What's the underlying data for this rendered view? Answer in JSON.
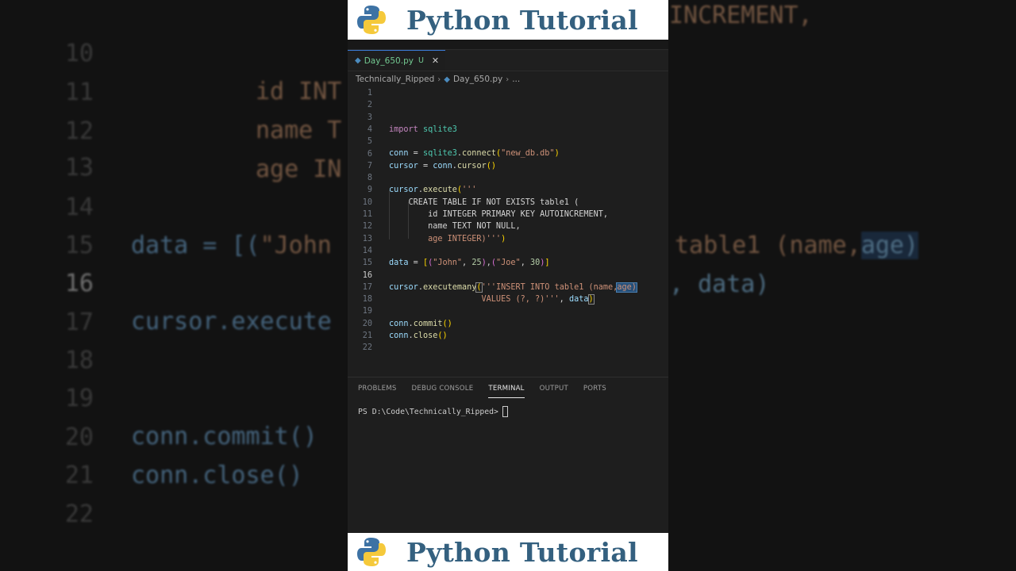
{
  "banner": {
    "title": "Python Tutorial"
  },
  "editor": {
    "tab": {
      "filename": "Day_650.py",
      "modified_badge": "U",
      "close_glyph": "✕"
    },
    "breadcrumb": {
      "folder": "Technically_Ripped",
      "file": "Day_650.py",
      "more": "..."
    },
    "current_line": "16",
    "line_numbers": [
      "1",
      "2",
      "3",
      "4",
      "5",
      "6",
      "7",
      "8",
      "9",
      "10",
      "11",
      "12",
      "13",
      "14",
      "15",
      "16",
      "17",
      "18",
      "19",
      "20",
      "21",
      "22"
    ],
    "code": {
      "l3_kw": "import",
      "l3_mod": "sqlite3",
      "l5_var": "conn",
      "l5_eq": " = ",
      "l5_mod": "sqlite3",
      "l5_dot": ".",
      "l5_fn": "connect",
      "l5_open": "(",
      "l5_str": "\"new_db.db\"",
      "l5_close": ")",
      "l6_var": "cursor",
      "l6_eq": " = ",
      "l6_var2": "conn",
      "l6_dot": ".",
      "l6_fn": "cursor",
      "l6_parens": "()",
      "l8_var": "cursor",
      "l8_dot": ".",
      "l8_fn": "execute",
      "l8_open": "(",
      "l8_str": "'''",
      "l9": "    CREATE TABLE IF NOT EXISTS table1 (",
      "l10": "        id INTEGER PRIMARY KEY AUTOINCREMENT,",
      "l11": "        name TEXT NOT NULL,",
      "l12_str": "        age INTEGER)'''",
      "l12_close": ")",
      "l14_var": "data",
      "l14_eq": " = ",
      "l14_b1": "[",
      "l14_b2a": "(",
      "l14_s1": "\"John\"",
      "l14_sep1": ", ",
      "l14_n1": "25",
      "l14_b2b": ")",
      "l14_comma": ",",
      "l14_b2c": "(",
      "l14_s2": "\"Joe\"",
      "l14_sep2": ", ",
      "l14_n2": "30",
      "l14_b2d": ")",
      "l14_b1e": "]",
      "l16_var": "cursor",
      "l16_dot": ".",
      "l16_fn": "executemany",
      "l16_open": "(",
      "l16_str": "'''INSERT INTO table1 (name,",
      "l16_sel": "age)",
      "l17_str": "                   VALUES (?, ?)'''",
      "l17_sep": ", ",
      "l17_var": "data",
      "l17_close": ")",
      "l19_var": "conn",
      "l19_dot": ".",
      "l19_fn": "commit",
      "l19_parens": "()",
      "l20_var": "conn",
      "l20_dot": ".",
      "l20_fn": "close",
      "l20_parens": "()"
    }
  },
  "panel": {
    "tabs": [
      "PROBLEMS",
      "DEBUG CONSOLE",
      "TERMINAL",
      "OUTPUT",
      "PORTS"
    ],
    "active_tab": "TERMINAL",
    "terminal_prompt": "PS D:\\Code\\Technically_Ripped>"
  },
  "background": {
    "line_numbers": [
      "10",
      "11",
      "12",
      "13",
      "14",
      "15",
      "16",
      "17",
      "18",
      "19",
      "20",
      "21",
      "22"
    ],
    "l10": "id INT",
    "l10_right": "INCREMENT,",
    "l11": "name T",
    "l12": "age IN",
    "l14_var": "data = [(",
    "l14_str": "\"John",
    "l16": "cursor.execute",
    "l16_right": "table1 (name,",
    "l16_sel": "age)",
    "l17_right": ", data)",
    "l19": "conn.commit()",
    "l20": "conn.close()"
  },
  "colors": {
    "banner_text": "#34607f",
    "editor_bg": "#1e1e1e",
    "accent": "#3a7bd5",
    "modified": "#73c991"
  },
  "icons": {
    "logo": "python-logo-icon",
    "file": "python-file-icon",
    "close": "close-icon",
    "chevron": "chevron-right-icon"
  }
}
